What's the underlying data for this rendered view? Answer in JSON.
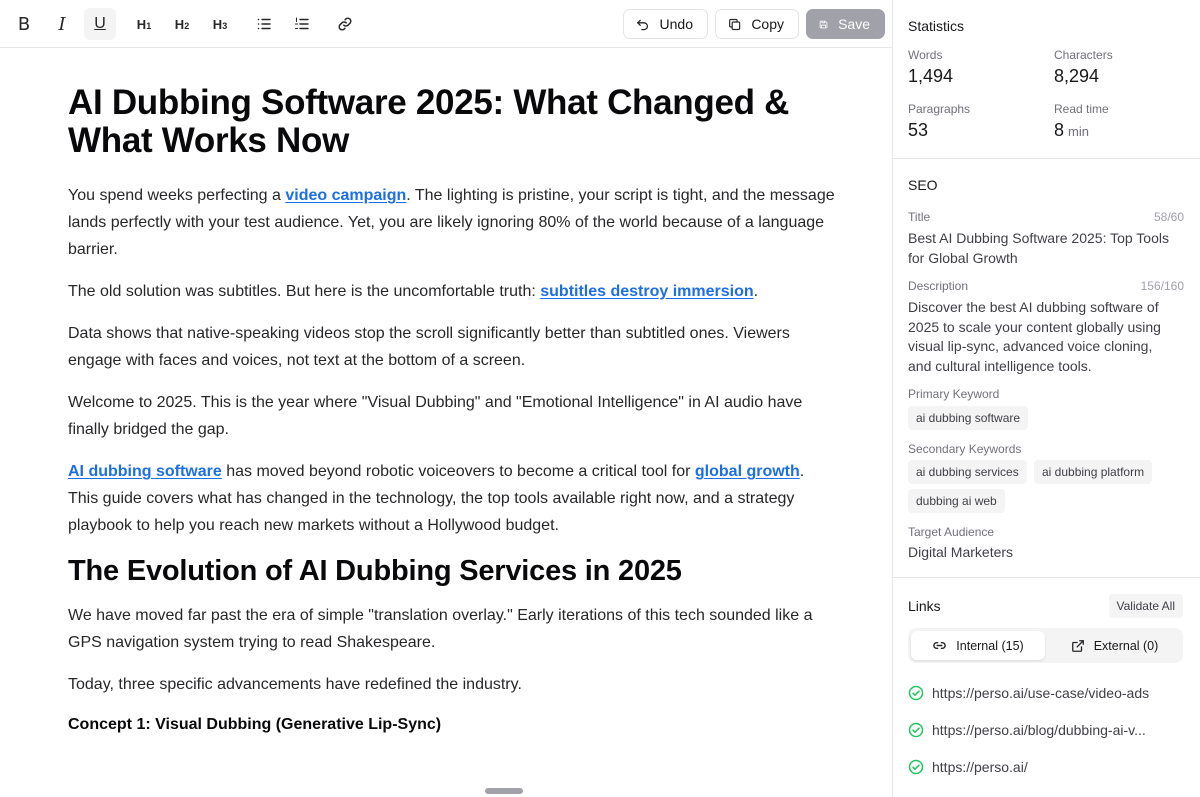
{
  "toolbar": {
    "format_buttons": {
      "bold": "B",
      "italic": "I",
      "underline": "U",
      "h1": "H",
      "h1_sub": "1",
      "h2": "H",
      "h2_sub": "2",
      "h3": "H",
      "h3_sub": "3"
    },
    "undo_label": "Undo",
    "copy_label": "Copy",
    "save_label": "Save"
  },
  "article": {
    "title": "AI Dubbing Software 2025: What Changed & What Works Now",
    "p1_before": "You spend weeks perfecting a ",
    "p1_link": "video campaign",
    "p1_after": ". The lighting is pristine, your script is tight, and the message lands perfectly with your test audience. Yet, you are likely ignoring 80% of the world because of a language barrier.",
    "p2_before": "The old solution was subtitles. But here is the uncomfortable truth: ",
    "p2_link": "subtitles destroy immersion",
    "p2_after": ".",
    "p3": "Data shows that native-speaking videos stop the scroll significantly better than subtitled ones. Viewers engage with faces and voices, not text at the bottom of a screen.",
    "p4": "Welcome to 2025. This is the year where \"Visual Dubbing\" and \"Emotional Intelligence\" in AI audio have finally bridged the gap.",
    "p5_link1": "AI dubbing software",
    "p5_mid": " has moved beyond robotic voiceovers to become a critical tool for ",
    "p5_link2": "global growth",
    "p5_after": ". This guide covers what has changed in the technology, the top tools available right now, and a strategy playbook to help you reach new markets without a Hollywood budget.",
    "h2": "The Evolution of AI Dubbing Services in 2025",
    "p6": "We have moved far past the era of simple \"translation overlay.\" Early iterations of this tech sounded like a GPS navigation system trying to read Shakespeare.",
    "p7": "Today, three specific advancements have redefined the industry.",
    "h4": "Concept 1: Visual Dubbing (Generative Lip-Sync)"
  },
  "statistics": {
    "title": "Statistics",
    "words_label": "Words",
    "words_value": "1,494",
    "characters_label": "Characters",
    "characters_value": "8,294",
    "paragraphs_label": "Paragraphs",
    "paragraphs_value": "53",
    "read_time_label": "Read time",
    "read_time_value": "8",
    "read_time_unit": "min"
  },
  "seo": {
    "title": "SEO",
    "title_label": "Title",
    "title_count": "58/60",
    "title_value": "Best AI Dubbing Software 2025: Top Tools for Global Growth",
    "description_label": "Description",
    "description_count": "156/160",
    "description_value": "Discover the best AI dubbing software of 2025 to scale your content globally using visual lip-sync, advanced voice cloning, and cultural intelligence tools.",
    "primary_keyword_label": "Primary Keyword",
    "primary_keyword": "ai dubbing software",
    "secondary_keywords_label": "Secondary Keywords",
    "secondary_keywords": [
      "ai dubbing services",
      "ai dubbing platform",
      "dubbing ai web"
    ],
    "target_audience_label": "Target Audience",
    "target_audience": "Digital Marketers"
  },
  "links": {
    "title": "Links",
    "validate_label": "Validate All",
    "tab_internal": "Internal (15)",
    "tab_external": "External (0)",
    "items": [
      "https://perso.ai/use-case/video-ads",
      "https://perso.ai/blog/dubbing-ai-v...",
      "https://perso.ai/"
    ]
  },
  "colors": {
    "link_blue": "#1d6fe8",
    "valid_green": "#22c55e",
    "save_disabled": "#a1a1aa"
  }
}
